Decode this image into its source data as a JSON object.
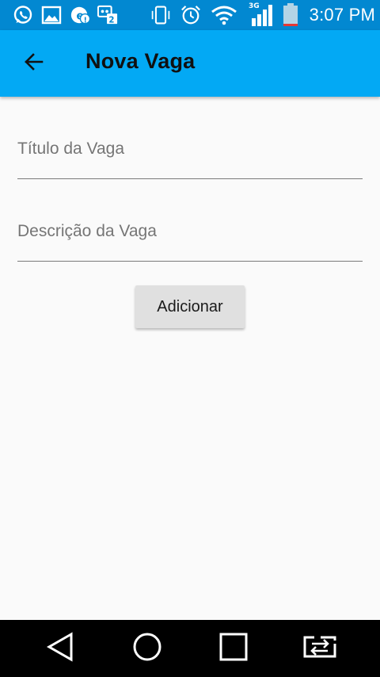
{
  "status_bar": {
    "time": "3:07 PM",
    "network_type": "3G",
    "left_icons": [
      "whatsapp-icon",
      "gallery-icon",
      "notification-app-icon",
      "chat-app-icon"
    ],
    "right_icons": [
      "vibrate-icon",
      "alarm-icon",
      "wifi-icon",
      "signal-icon",
      "battery-icon"
    ]
  },
  "app_bar": {
    "title": "Nova Vaga",
    "back_icon": "arrow-back-icon",
    "background_color": "#03a9f4"
  },
  "form": {
    "title_field": {
      "label": "Título da Vaga",
      "value": ""
    },
    "description_field": {
      "label": "Descrição da Vaga",
      "value": ""
    },
    "submit_label": "Adicionar"
  },
  "nav_bar": {
    "buttons": [
      "back-triangle-icon",
      "home-circle-icon",
      "recents-square-icon",
      "dual-window-icon"
    ]
  }
}
